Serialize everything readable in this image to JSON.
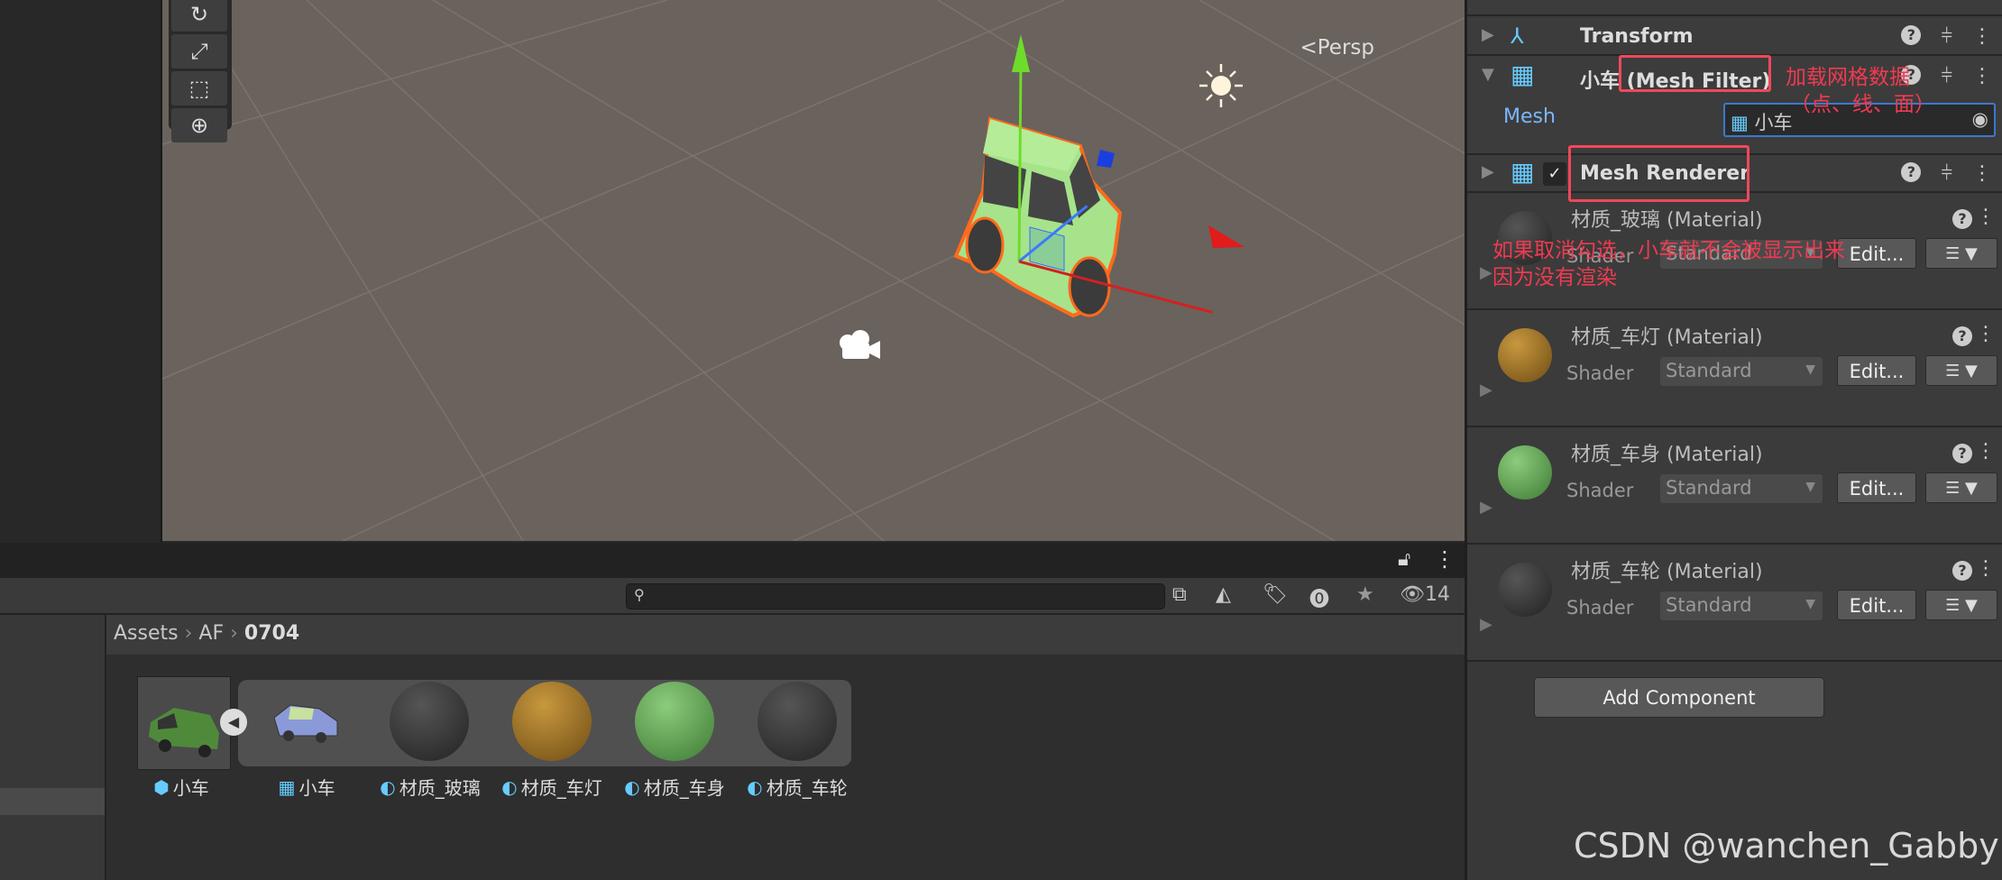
{
  "scene": {
    "persp_label": "Persp"
  },
  "inspector": {
    "transform": {
      "title": "Transform"
    },
    "mesh_filter": {
      "title_prefix": "小车",
      "title": "(Mesh Filter)",
      "mesh_label": "Mesh",
      "mesh_value": "小车"
    },
    "mesh_renderer": {
      "title": "Mesh Renderer",
      "enabled": true
    },
    "materials": [
      {
        "name": "材质_玻璃 (Material)",
        "shader_label": "Shader",
        "shader": "Standard",
        "edit": "Edit...",
        "color": "#2d2f33"
      },
      {
        "name": "材质_车灯 (Material)",
        "shader_label": "Shader",
        "shader": "Standard",
        "edit": "Edit...",
        "color": "#a8782c"
      },
      {
        "name": "材质_车身 (Material)",
        "shader_label": "Shader",
        "shader": "Standard",
        "edit": "Edit...",
        "color": "#6aad5c"
      },
      {
        "name": "材质_车轮 (Material)",
        "shader_label": "Shader",
        "shader": "Standard",
        "edit": "Edit...",
        "color": "#2d2f33"
      }
    ],
    "add_component": "Add Component"
  },
  "annotations": {
    "mesh_filter_note_1": "加载网格数据",
    "mesh_filter_note_2": "（点、线、面）",
    "renderer_note_1": "如果取消勾选，小车就不会被显示出来",
    "renderer_note_2": "因为没有渲染"
  },
  "project": {
    "breadcrumb": [
      "Assets",
      "AF",
      "0704"
    ],
    "hidden_count": "14",
    "assets": [
      {
        "label": "小车",
        "type": "prefab"
      },
      {
        "label": "小车",
        "type": "mesh"
      },
      {
        "label": "材质_玻璃",
        "type": "material",
        "color": "#2d2f33"
      },
      {
        "label": "材质_车灯",
        "type": "material",
        "color": "#a8782c"
      },
      {
        "label": "材质_车身",
        "type": "material",
        "color": "#6aad5c"
      },
      {
        "label": "材质_车轮",
        "type": "material",
        "color": "#2d2f33"
      }
    ]
  },
  "watermark": "CSDN @wanchen_Gabby"
}
